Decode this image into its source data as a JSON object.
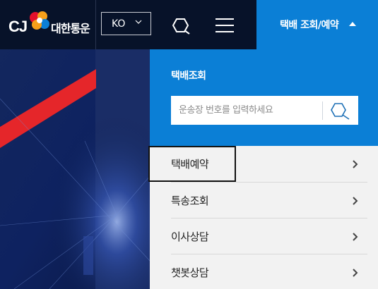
{
  "header": {
    "logo_text": "CJ",
    "brand_name": "대한통운",
    "language": "KO",
    "track_button_label": "택배 조회/예약"
  },
  "panel": {
    "title": "택배조회",
    "search_placeholder": "운송장 번호를 입력하세요",
    "items": [
      {
        "label": "택배예약"
      },
      {
        "label": "특송조회"
      },
      {
        "label": "이사상담"
      },
      {
        "label": "챗봇상담"
      }
    ]
  },
  "colors": {
    "header_bg": "#071229",
    "accent_blue": "#0b7fd6",
    "list_bg": "#f2f2f2"
  },
  "icons": {
    "search": "search-icon",
    "menu": "hamburger-menu-icon",
    "chevron": "chevron-down-icon",
    "arrow": "chevron-right-icon"
  }
}
